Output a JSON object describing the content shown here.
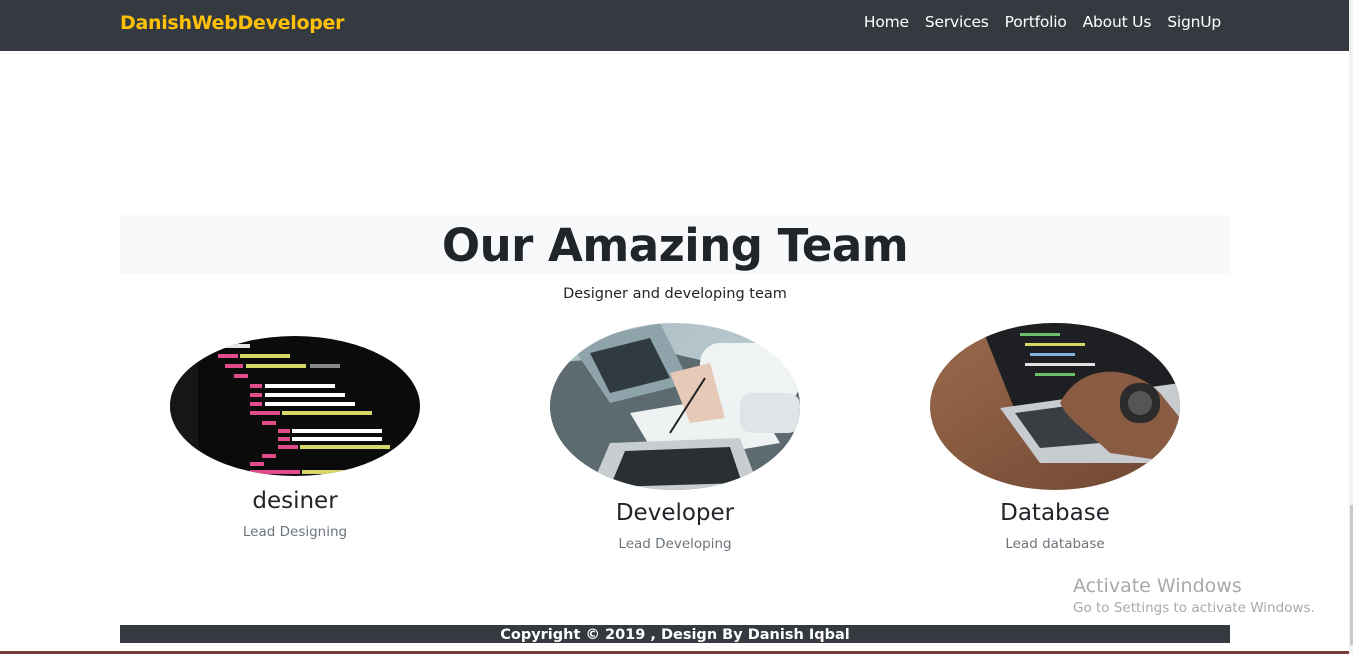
{
  "navbar": {
    "brand": "DanishWebDeveloper",
    "links": [
      "Home",
      "Services",
      "Portfolio",
      "About Us",
      "SignUp"
    ],
    "background": "#343a40",
    "brand_color": "#ffc107"
  },
  "team": {
    "title": "Our Amazing Team",
    "subtitle": "Designer and developing team",
    "members": [
      {
        "name": "desiner",
        "role": "Lead Designing",
        "image": "code-screen-image"
      },
      {
        "name": "Developer",
        "role": "Lead Developing",
        "image": "meeting-laptop-image"
      },
      {
        "name": "Database",
        "role": "Lead database",
        "image": "typing-laptop-image"
      }
    ]
  },
  "watermark": {
    "title": "Activate Windows",
    "subtitle": "Go to Settings to activate Windows."
  },
  "footer": {
    "text": "Copyright © 2019 , Design By Danish Iqbal"
  }
}
